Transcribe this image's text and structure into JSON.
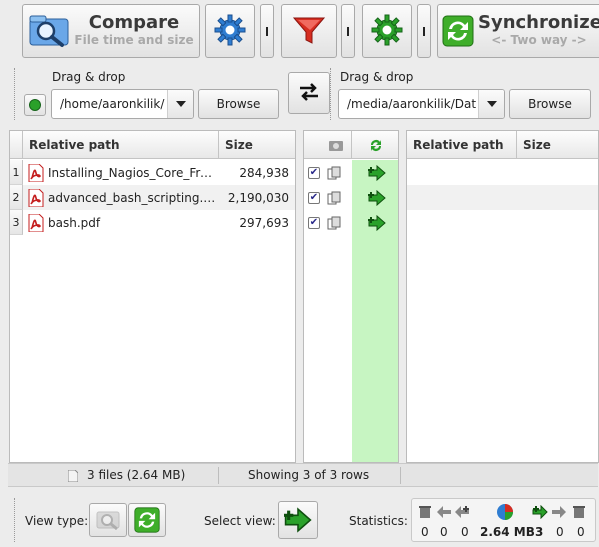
{
  "toolbar": {
    "compare": {
      "title": "Compare",
      "subtitle": "File time and size",
      "icon": "compare-magnifier-icon"
    },
    "compare_settings_icon": "gear-icon",
    "filter_icon": "funnel-icon",
    "sync_settings_icon": "gear-icon",
    "synchronize": {
      "title": "Synchronize",
      "subtitle": "<- Two way ->",
      "icon": "sync-arrows-icon"
    }
  },
  "folders": {
    "left": {
      "label": "Drag & drop",
      "path": "/home/aaronkilik/",
      "browse": "Browse"
    },
    "swap_icon": "swap-arrows-icon",
    "right": {
      "label": "Drag & drop",
      "path": "/media/aaronkilik/Dat",
      "browse": "Browse"
    }
  },
  "left_grid": {
    "columns": [
      "Relative path",
      "Size"
    ],
    "rows": [
      {
        "num": "1",
        "name": "Installing_Nagios_Core_Fro...",
        "size": "284,938"
      },
      {
        "num": "2",
        "name": "advanced_bash_scripting.pdf",
        "size": "2,190,030"
      },
      {
        "num": "3",
        "name": "bash.pdf",
        "size": "297,693"
      }
    ]
  },
  "middle_grid": {
    "checked": [
      "✔",
      "✔",
      "✔"
    ]
  },
  "right_grid": {
    "columns": [
      "Relative path",
      "Size"
    ]
  },
  "status": {
    "left": "3 files (2.64 MB)",
    "center": "Showing 3 of 3 rows"
  },
  "bottom": {
    "view_type_label": "View type:",
    "select_view_label": "Select view:",
    "statistics_label": "Statistics:",
    "stats": {
      "left_delete": "0",
      "conflicts": "0",
      "updates": "0",
      "data": "2.64 MB",
      "create_right": "3",
      "update_right": "0",
      "delete_right": "0"
    }
  },
  "colors": {
    "accent_green": "#2aa12a",
    "sync_bg": "#c7f5c2",
    "filter_red": "#d62d20",
    "gear_blue": "#2f7dd1"
  }
}
